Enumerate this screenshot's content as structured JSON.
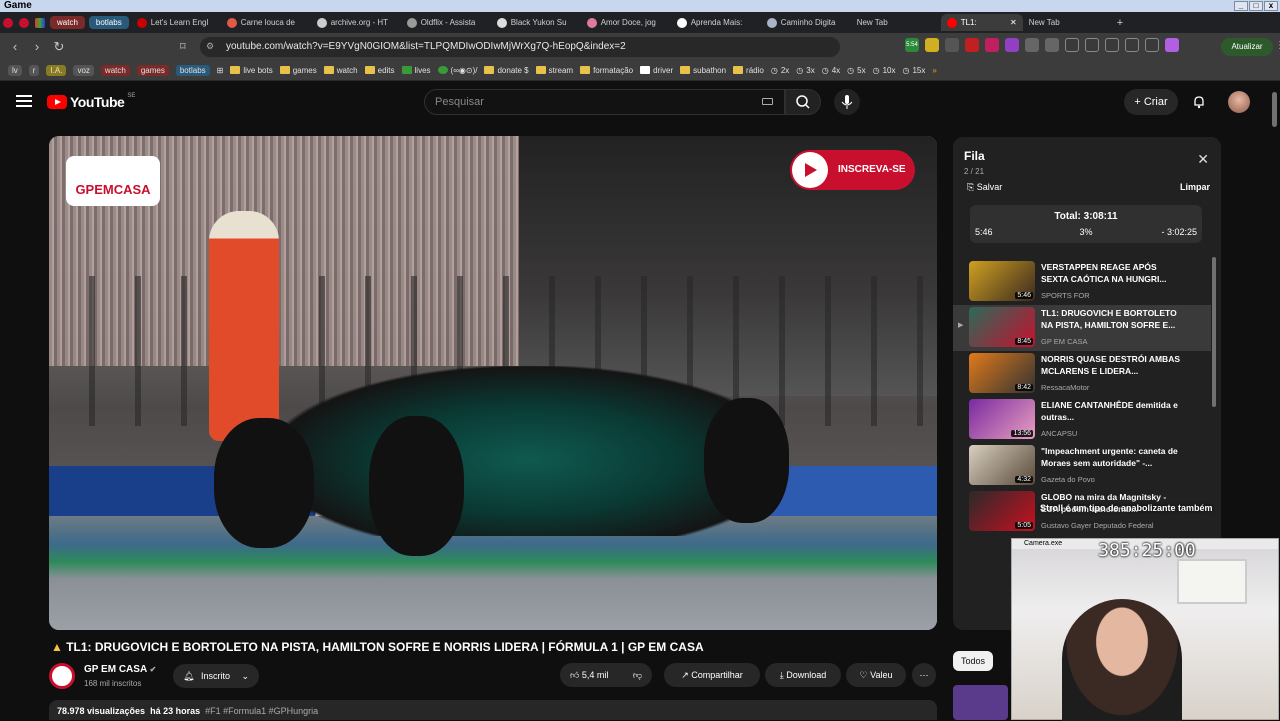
{
  "os": {
    "title": "Game"
  },
  "tabs": {
    "groups": [
      "watch",
      "botlabs"
    ],
    "items": [
      {
        "label": "Let's Learn Engl",
        "color": "#cc0000"
      },
      {
        "label": "Carne louca de",
        "color": "#e05a47"
      },
      {
        "label": "archive.org - HT",
        "color": "#cccccc"
      },
      {
        "label": "Oldflix - Assista",
        "color": "#9a9a9a"
      },
      {
        "label": "Black Yukon Su",
        "color": "#dddddd"
      },
      {
        "label": "Amor Doce, jog",
        "color": "#e07a9a"
      },
      {
        "label": "Aprenda Mais:",
        "color": "#ffffff"
      },
      {
        "label": "Caminho Digita",
        "color": "#aab4c8"
      },
      {
        "label": "New Tab",
        "color": ""
      },
      {
        "label": "TL1:",
        "color": "#ff0000"
      },
      {
        "label": "New Tab",
        "color": ""
      }
    ]
  },
  "address": {
    "url": "youtube.com/watch?v=E9YVgN0GIOM&list=TLPQMDIwODIwMjWrXg7Q-hEopQ&index=2",
    "badge": "5:54",
    "update_label": "Atualizar"
  },
  "bookmarks": {
    "chips": [
      "lv",
      "r",
      "I.A.",
      "voz",
      "watch",
      "games",
      "botlabs"
    ],
    "items": [
      "live bots",
      "games",
      "watch",
      "edits",
      "lives",
      "(∞◉⊙)/",
      "donate $",
      "stream",
      "formatação",
      "driver",
      "subathon",
      "rádio",
      "2x",
      "3x",
      "4x",
      "5x",
      "10x",
      "15x"
    ]
  },
  "header": {
    "region": "SE",
    "search_placeholder": "Pesquisar",
    "create_label": "Criar",
    "logo_text": "YouTube"
  },
  "video": {
    "overlay_logo": "GPEMCASA",
    "overlay_subscribe": "INSCREVA-SE",
    "title": "TL1: DRUGOVICH E BORTOLETO NA PISTA, HAMILTON SOFRE E NORRIS LIDERA | FÓRMULA 1 | GP EM CASA",
    "channel": "GP EM CASA",
    "subscribers": "168 mil inscritos",
    "subscribed_label": "Inscrito",
    "likes": "5,4 mil",
    "share_label": "Compartilhar",
    "download_label": "Download",
    "thanks_label": "Valeu",
    "views": "78.978 visualizações",
    "age": "há 23 horas",
    "tags": "#F1 #Formula1 #GPHungria"
  },
  "queue": {
    "title": "Fila",
    "position": "2 / 21",
    "save_label": "Salvar",
    "clear_label": "Limpar",
    "total": "Total: 3:08:11",
    "elapsed": "5:46",
    "percent": "3%",
    "remaining": "- 3:02:25",
    "progress": 0.03,
    "items": [
      {
        "title": "VERSTAPPEN REAGE APÓS SEXTA CAÓTICA NA HUNGRI...",
        "channel": "SPORTS FOR",
        "duration": "5:46",
        "colors": [
          "#d0a020",
          "#3a2a20"
        ]
      },
      {
        "title": "TL1: DRUGOVICH E BORTOLETO NA PISTA, HAMILTON SOFRE E...",
        "channel": "GP EM CASA",
        "duration": "8:45",
        "colors": [
          "#2a6a5a",
          "#c8102e"
        ]
      },
      {
        "title": "NORRIS QUASE DESTRÓI AMBAS MCLARENS E LIDERA...",
        "channel": "RessacaMotor",
        "duration": "8:42",
        "colors": [
          "#e07a1a",
          "#333333"
        ]
      },
      {
        "title": "ELIANE CANTANHÊDE demitida e outras...",
        "channel": "ANCAPSU",
        "duration": "13:56",
        "colors": [
          "#7a2aa0",
          "#e8a0c0"
        ]
      },
      {
        "title": "\"Impeachment urgente: caneta de Moraes sem autoridade\" -...",
        "channel": "Gazeta do Povo",
        "duration": "4:32",
        "colors": [
          "#d8d0c0",
          "#5a4a3a"
        ]
      },
      {
        "title": "GLOBO na mira da Magnitsky - EUA podem sancionar...",
        "channel": "Gustavo Gayer Deputado Federal",
        "duration": "5:05",
        "colors": [
          "#2a2a2a",
          "#c81020"
        ]
      }
    ]
  },
  "filters": {
    "all_label": "Todos"
  },
  "overlay": {
    "text": "Stroll é um tipo de anabolizante também",
    "cam_window_title": "Camera.exe",
    "timer": "385:25:00"
  }
}
